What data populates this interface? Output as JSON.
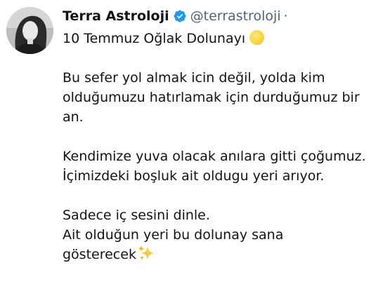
{
  "tweet": {
    "author_name": "Terra Astroloji",
    "handle": "@terrastroloji",
    "separator": "·",
    "title_line": "10 Temmuz Oğlak Dolunayı",
    "paragraph1": [
      "Bu sefer yol almak icin değil,  yolda kim",
      "olduğumuzu hatırlamak için durduğumuz bir",
      "an."
    ],
    "paragraph2": [
      "Kendimize yuva olacak anılara gitti çoğumuz.",
      "İçimizdeki boşluk ait oldugu yeri arıyor."
    ],
    "paragraph3": [
      "Sadece iç sesini dinle.",
      "Ait olduğun yeri bu dolunay sana",
      "gösterecek"
    ],
    "icons": {
      "verified": "verified-badge-icon",
      "moon": "full-moon-emoji",
      "sparkles": "sparkles-emoji"
    },
    "colors": {
      "text": "#0f1419",
      "secondary": "#536471",
      "verified": "#1d9bf0",
      "sparkle": "#ffc83d"
    }
  }
}
